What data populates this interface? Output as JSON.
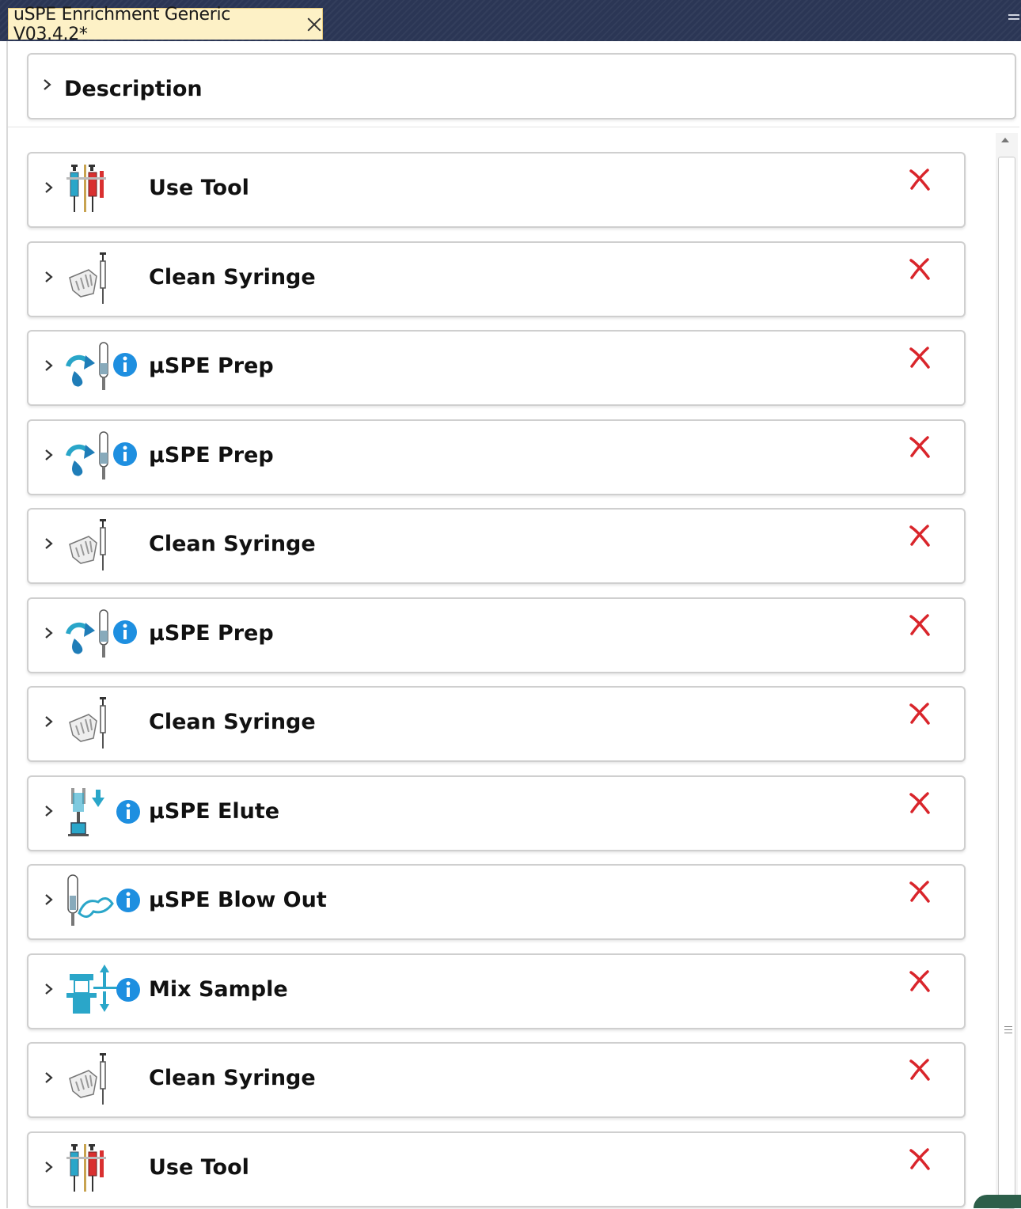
{
  "tab": {
    "title": "uSPE Enrichment Generic V03.4.2*"
  },
  "description": {
    "label": "Description"
  },
  "steps": [
    {
      "label": "Use Tool",
      "icon": "use-tool-icon",
      "info": false
    },
    {
      "label": "Clean Syringe",
      "icon": "clean-syringe-icon",
      "info": false
    },
    {
      "label": "µSPE Prep",
      "icon": "uspe-prep-icon",
      "info": true
    },
    {
      "label": "µSPE Prep",
      "icon": "uspe-prep-icon",
      "info": true
    },
    {
      "label": "Clean Syringe",
      "icon": "clean-syringe-icon",
      "info": false
    },
    {
      "label": "µSPE Prep",
      "icon": "uspe-prep-icon",
      "info": true
    },
    {
      "label": "Clean Syringe",
      "icon": "clean-syringe-icon",
      "info": false
    },
    {
      "label": "µSPE Elute",
      "icon": "uspe-elute-icon",
      "info": true
    },
    {
      "label": "µSPE Blow Out",
      "icon": "uspe-blow-out-icon",
      "info": true
    },
    {
      "label": "Mix Sample",
      "icon": "mix-sample-icon",
      "info": true
    },
    {
      "label": "Clean Syringe",
      "icon": "clean-syringe-icon",
      "info": false
    },
    {
      "label": "Use Tool",
      "icon": "use-tool-icon",
      "info": false
    }
  ],
  "colors": {
    "titlebar": "#2b3655",
    "tab": "#fdf1c6",
    "delete": "#d9252b",
    "info": "#1e8fe0",
    "teal": "#2aa6c9"
  }
}
